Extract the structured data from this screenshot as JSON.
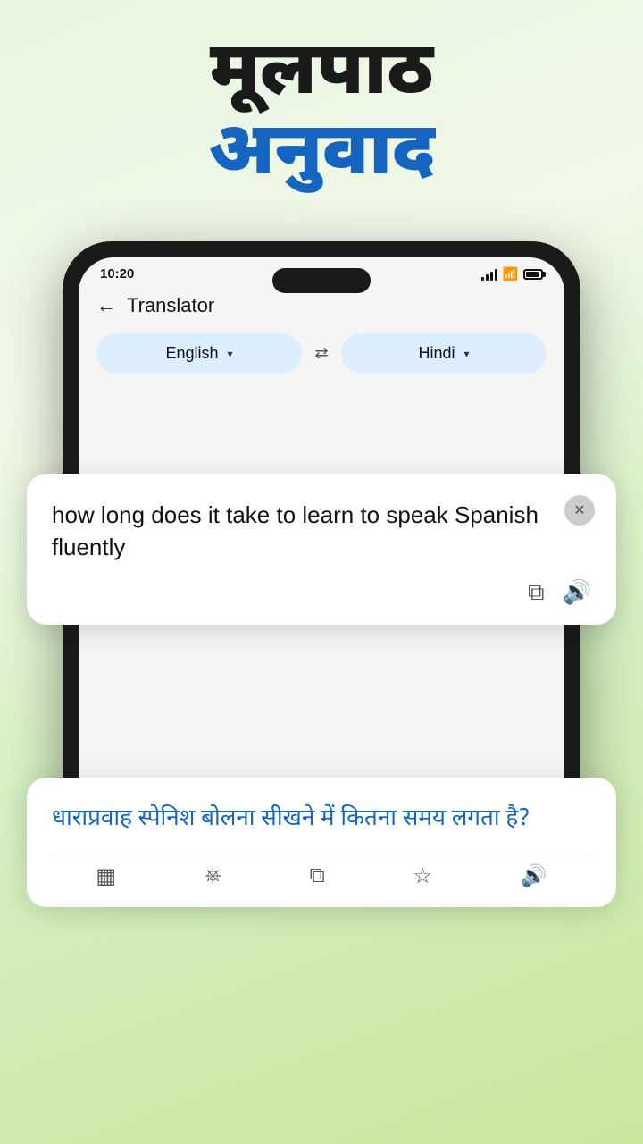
{
  "header": {
    "title_original": "मूलपाठ",
    "title_translated": "अनुवाद"
  },
  "phone": {
    "status_bar": {
      "time": "10:20"
    },
    "app_bar": {
      "title": "Translator"
    },
    "lang_source": "English",
    "lang_target": "Hindi"
  },
  "input_card": {
    "text": "how long does it take to learn to speak Spanish fluently"
  },
  "output_card": {
    "text": "धाराप्रवाह स्पेनिश बोलना सीखने में कितना समय लगता है?"
  },
  "icons": {
    "back": "←",
    "chevron_down": "▾",
    "swap": "⇄",
    "clear": "✕",
    "copy": "⧉",
    "volume": "🔊",
    "fullscreen": "⛶",
    "share": "⎙",
    "star": "☆",
    "volume2": "🔊"
  }
}
